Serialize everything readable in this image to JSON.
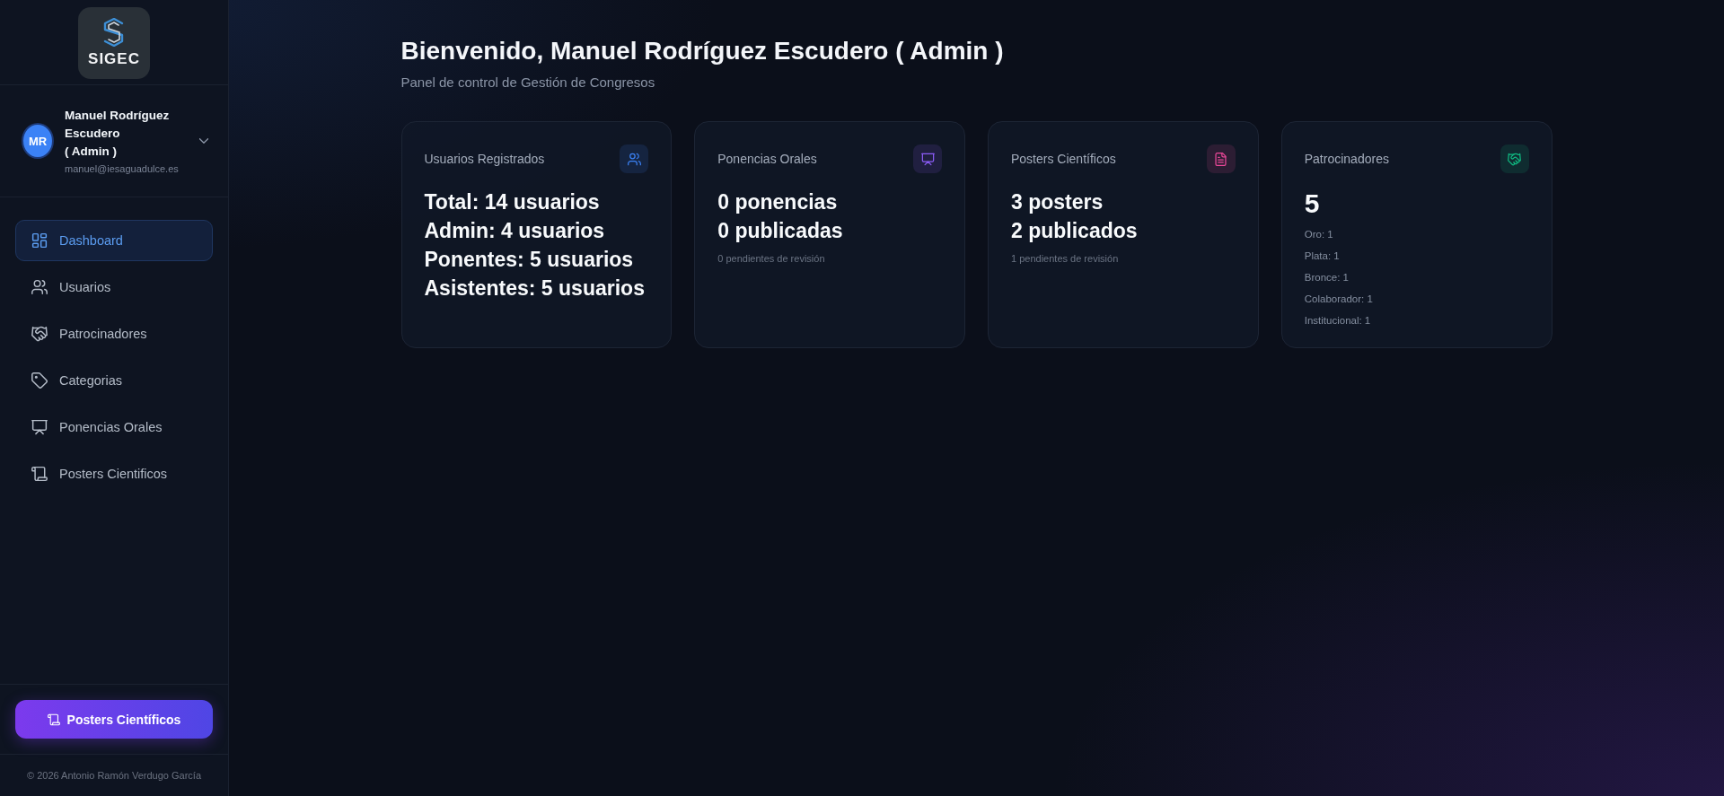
{
  "brand": {
    "name": "SIGEC"
  },
  "user": {
    "initials": "MR",
    "name": "Manuel Rodríguez Escudero",
    "role": "( Admin )",
    "email": "manuel@iesaguadulce.es"
  },
  "nav": [
    {
      "label": "Dashboard",
      "selected": true
    },
    {
      "label": "Usuarios",
      "selected": false
    },
    {
      "label": "Patrocinadores",
      "selected": false
    },
    {
      "label": "Categorias",
      "selected": false
    },
    {
      "label": "Ponencias Orales",
      "selected": false
    },
    {
      "label": "Posters Cientificos",
      "selected": false
    }
  ],
  "sidebar_button": {
    "label": "Posters Científicos"
  },
  "footer": "© 2026 Antonio Ramón Verdugo García",
  "header": {
    "title": "Bienvenido, Manuel Rodríguez Escudero ( Admin )",
    "subtitle": "Panel de control de Gestión de Congresos"
  },
  "cards": [
    {
      "kind": "stats",
      "title": "Usuarios Registrados",
      "color": "#3b82f6",
      "lines": [
        "Total: 14 usuarios",
        "Admin: 4 usuarios",
        "Ponentes: 5 usuarios",
        "Asistentes: 5 usuarios"
      ]
    },
    {
      "kind": "stats",
      "title": "Ponencias Orales",
      "color": "#8b5cf6",
      "lines": [
        "0 ponencias",
        "0 publicadas"
      ],
      "note": "0 pendientes de revisión"
    },
    {
      "kind": "stats",
      "title": "Posters Científicos",
      "color": "#ec4899",
      "lines": [
        "3 posters",
        "2 publicados"
      ],
      "note": "1 pendientes de revisión"
    },
    {
      "kind": "breakdown",
      "title": "Patrocinadores",
      "color": "#10b981",
      "total": "5",
      "items": [
        "Oro: 1",
        "Plata: 1",
        "Bronce: 1",
        "Colaborador: 1",
        "Institucional: 1"
      ]
    }
  ]
}
